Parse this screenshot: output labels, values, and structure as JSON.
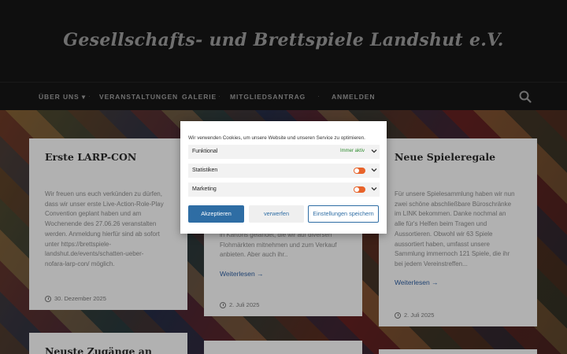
{
  "site": {
    "title": "Gesellschafts- und Brettspiele Landshut e.V."
  },
  "nav": {
    "items": [
      "ÜBER UNS",
      "VERANSTALTUNGEN",
      "GALERIE",
      "MITGLIEDSANTRAG",
      "ANMELDEN"
    ]
  },
  "cards": [
    {
      "title": "Erste LARP-CON",
      "lines": [
        "Wir freuen uns euch verkünden zu dürfen,",
        "dass wir unser erste Live-Action-Role-Play",
        "Convention geplant haben und am",
        "Wochenende des 27.06.26 veranstalten",
        "werden. Anmeldung hierfür sind ab sofort",
        "unter https://brettspiele-",
        "landshut.de/events/schatten-ueber-",
        "nofara-larp-con/ möglich."
      ],
      "date": "30. Dezember 2025"
    },
    {
      "lines": [
        "in Kartons gelandet, die wir auf diversen",
        "Flohmärkten mitnehmen und zum Verkauf",
        "anbieten. Aber auch ihr.."
      ],
      "read_more": "Weiterlesen →",
      "date": "2. Juli 2025"
    },
    {
      "title": "Neue Spieleregale",
      "lines": [
        "Für unsere Spielesammlung haben wir nun",
        "zwei schöne abschließbare Büroschränke",
        "im LINK bekommen. Danke nochmal an",
        "alle für's Helfen beim Tragen und",
        "Aussortieren. Obwohl wir 63 Spiele",
        "aussortiert haben, umfasst unsere",
        "Sammlung immernoch 121 Spiele, die ihr",
        "bei jedem Vereinstreffen..."
      ],
      "read_more": "Weiterlesen →",
      "date": "2. Juli 2025"
    },
    {
      "title": "Neuste Zugänge an"
    }
  ],
  "cookie": {
    "intro": "Wir verwenden Cookies, um unsere Website und unseren Service zu optimieren.",
    "categories": [
      {
        "label": "Funktional",
        "status": "Immer aktiv"
      },
      {
        "label": "Statistiken"
      },
      {
        "label": "Marketing"
      }
    ],
    "accept": "Akzeptieren",
    "deny": "verwerfen",
    "settings": "Einstellungen speichern",
    "accent": "#2e6da4",
    "toggle_color": "#e8632a"
  }
}
